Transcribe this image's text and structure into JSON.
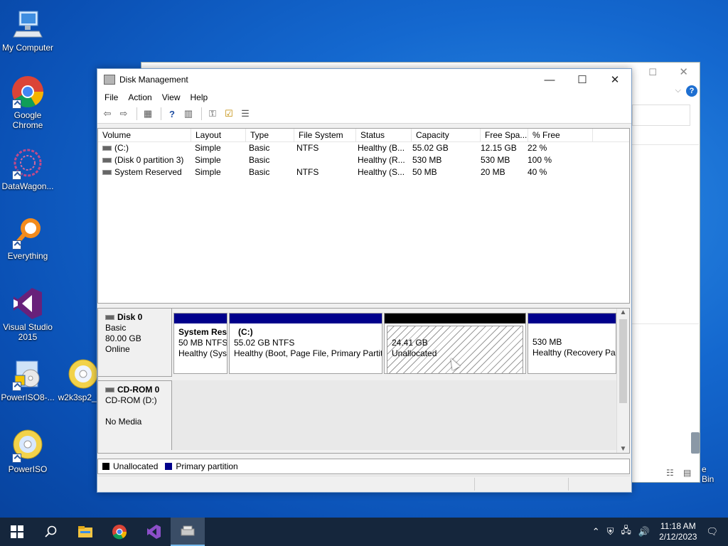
{
  "desktop": {
    "icons": [
      {
        "label": "My Computer"
      },
      {
        "label": "Google Chrome"
      },
      {
        "label": "DataWagon..."
      },
      {
        "label": "Everything"
      },
      {
        "label": "Visual Studio 2015"
      },
      {
        "label": "PowerISO8-..."
      },
      {
        "label": "w2k3sp2_3..."
      },
      {
        "label": "PowerISO"
      }
    ],
    "recycle_partial": "e Bin"
  },
  "window": {
    "title": "Disk Management",
    "minimize": "—",
    "maximize": "☐",
    "close": "✕"
  },
  "menu": [
    "File",
    "Action",
    "View",
    "Help"
  ],
  "volumes": {
    "columns": [
      "Volume",
      "Layout",
      "Type",
      "File System",
      "Status",
      "Capacity",
      "Free Spa...",
      "% Free"
    ],
    "rows": [
      [
        "(C:)",
        "Simple",
        "Basic",
        "NTFS",
        "Healthy (B...",
        "55.02 GB",
        "12.15 GB",
        "22 %"
      ],
      [
        "(Disk 0 partition 3)",
        "Simple",
        "Basic",
        "",
        "Healthy (R...",
        "530 MB",
        "530 MB",
        "100 %"
      ],
      [
        "System Reserved",
        "Simple",
        "Basic",
        "NTFS",
        "Healthy (S...",
        "50 MB",
        "20 MB",
        "40 %"
      ]
    ]
  },
  "disk0": {
    "name": "Disk 0",
    "type": "Basic",
    "size": "80.00 GB",
    "state": "Online",
    "partitions": [
      {
        "title": "System Res",
        "line1": "50 MB NTFS",
        "line2": "Healthy (Sys"
      },
      {
        "title": "(C:)",
        "line1": "55.02 GB NTFS",
        "line2": "Healthy (Boot, Page File, Primary Partit"
      },
      {
        "line1": "24.41 GB",
        "line2": "Unallocated"
      },
      {
        "line1": "530 MB",
        "line2": "Healthy (Recovery Pa"
      }
    ]
  },
  "cdrom0": {
    "name": "CD-ROM 0",
    "type": "CD-ROM (D:)",
    "media": "No Media"
  },
  "legend": {
    "unallocated": "Unallocated",
    "primary": "Primary partition"
  },
  "colors": {
    "primary_partition": "#00008b",
    "unallocated": "#000000",
    "taskbar": "#15263c"
  },
  "taskbar": {
    "time": "11:18 AM",
    "date": "2/12/2023"
  }
}
